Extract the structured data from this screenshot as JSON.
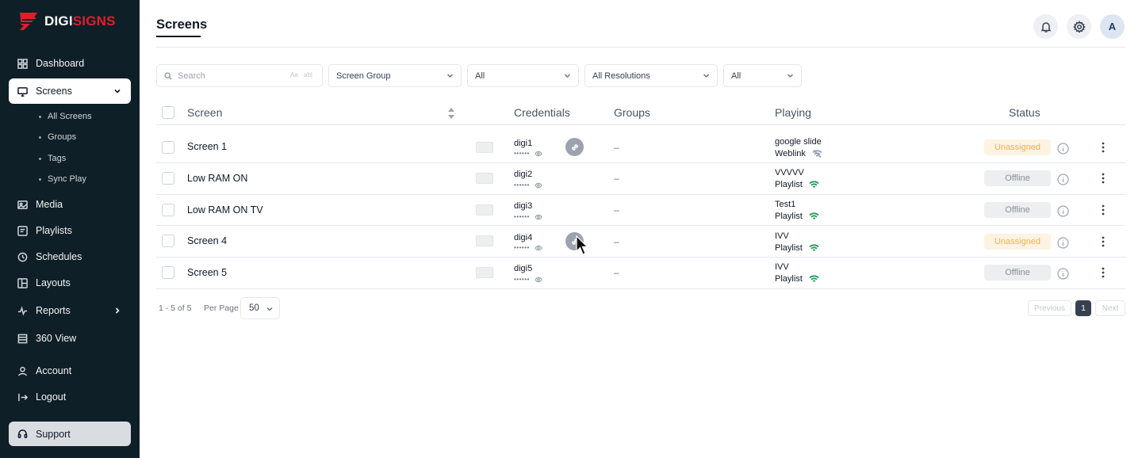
{
  "brand": {
    "name_part1": "DIGI",
    "name_part2": "SIGNS",
    "accent": "#e11d2b"
  },
  "sidebar": {
    "items": [
      {
        "label": "Dashboard",
        "icon": "grid-icon"
      },
      {
        "label": "Screens",
        "icon": "monitor-icon"
      },
      {
        "label": "Media",
        "icon": "image-icon"
      },
      {
        "label": "Playlists",
        "icon": "playlist-icon"
      },
      {
        "label": "Schedules",
        "icon": "clock-icon"
      },
      {
        "label": "Layouts",
        "icon": "layout-icon"
      },
      {
        "label": "Reports",
        "icon": "chart-icon"
      },
      {
        "label": "360 View",
        "icon": "table-icon"
      },
      {
        "label": "Account",
        "icon": "user-icon"
      },
      {
        "label": "Logout",
        "icon": "logout-icon"
      },
      {
        "label": "Support",
        "icon": "headset-icon"
      }
    ],
    "screens_sub": [
      "All Screens",
      "Groups",
      "Tags",
      "Sync Play"
    ]
  },
  "header": {
    "title": "Screens",
    "avatar_letter": "A"
  },
  "filters": {
    "search_placeholder": "Search",
    "search_opt1": "Aa",
    "search_opt2": "ab|",
    "screen_group": "Screen Group",
    "filter2": "All",
    "resolutions": "All Resolutions",
    "filter4": "All"
  },
  "table": {
    "columns": [
      "Screen",
      "Credentials",
      "Groups",
      "Playing",
      "Status"
    ],
    "rows": [
      {
        "screen": "Screen 1",
        "user": "digi1",
        "pass": "••••••",
        "groups": "–",
        "playing": "google slide",
        "type": "Weblink",
        "status": "Unassigned",
        "linked": true,
        "online": false
      },
      {
        "screen": "Low RAM ON",
        "user": "digi2",
        "pass": "••••••",
        "groups": "–",
        "playing": "VVVVV",
        "type": "Playlist",
        "status": "Offline",
        "linked": false,
        "online": true
      },
      {
        "screen": "Low RAM ON TV",
        "user": "digi3",
        "pass": "••••••",
        "groups": "–",
        "playing": "Test1",
        "type": "Playlist",
        "status": "Offline",
        "linked": false,
        "online": true
      },
      {
        "screen": "Screen 4",
        "user": "digi4",
        "pass": "••••••",
        "groups": "–",
        "playing": "IVV",
        "type": "Playlist",
        "status": "Unassigned",
        "linked": true,
        "online": true
      },
      {
        "screen": "Screen 5",
        "user": "digi5",
        "pass": "••••••",
        "groups": "–",
        "playing": "IVV",
        "type": "Playlist",
        "status": "Offline",
        "linked": false,
        "online": true
      }
    ]
  },
  "pagination": {
    "range": "1 - 5 of 5",
    "per_page_label": "Per Page",
    "per_page": "50",
    "previous": "Previous",
    "current": "1",
    "next": "Next"
  }
}
